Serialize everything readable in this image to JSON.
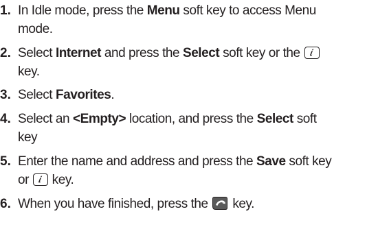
{
  "steps": [
    {
      "num": "1.",
      "lines": [
        {
          "pre": "In Idle mode, press the ",
          "bold": "Menu",
          "post": " soft key to access Menu"
        },
        {
          "text": "mode."
        }
      ]
    },
    {
      "num": "2.",
      "lines": [
        {
          "pre": "Select ",
          "bold1": "Internet",
          "mid": " and press the ",
          "bold2": "Select",
          "post": " soft key or the "
        },
        {
          "text": "key."
        }
      ]
    },
    {
      "num": "3.",
      "lines": [
        {
          "pre": "Select ",
          "bold": "Favorites",
          "post": "."
        }
      ]
    },
    {
      "num": "4.",
      "lines": [
        {
          "pre": "Select an ",
          "bold1": "<Empty>",
          "mid": " location, and press the ",
          "bold2": "Select",
          "post": " soft"
        },
        {
          "text": "key"
        }
      ]
    },
    {
      "num": "5.",
      "lines": [
        {
          "pre": "Enter the name and address and press the ",
          "bold": "Save",
          "post": " soft key"
        },
        {
          "pre": "or ",
          "post": " key."
        }
      ]
    },
    {
      "num": "6.",
      "lines": [
        {
          "pre": "When you have finished, press the ",
          "post": " key."
        }
      ]
    }
  ],
  "icons": {
    "i_key": "i-key-icon",
    "end_key": "end-key-icon"
  }
}
